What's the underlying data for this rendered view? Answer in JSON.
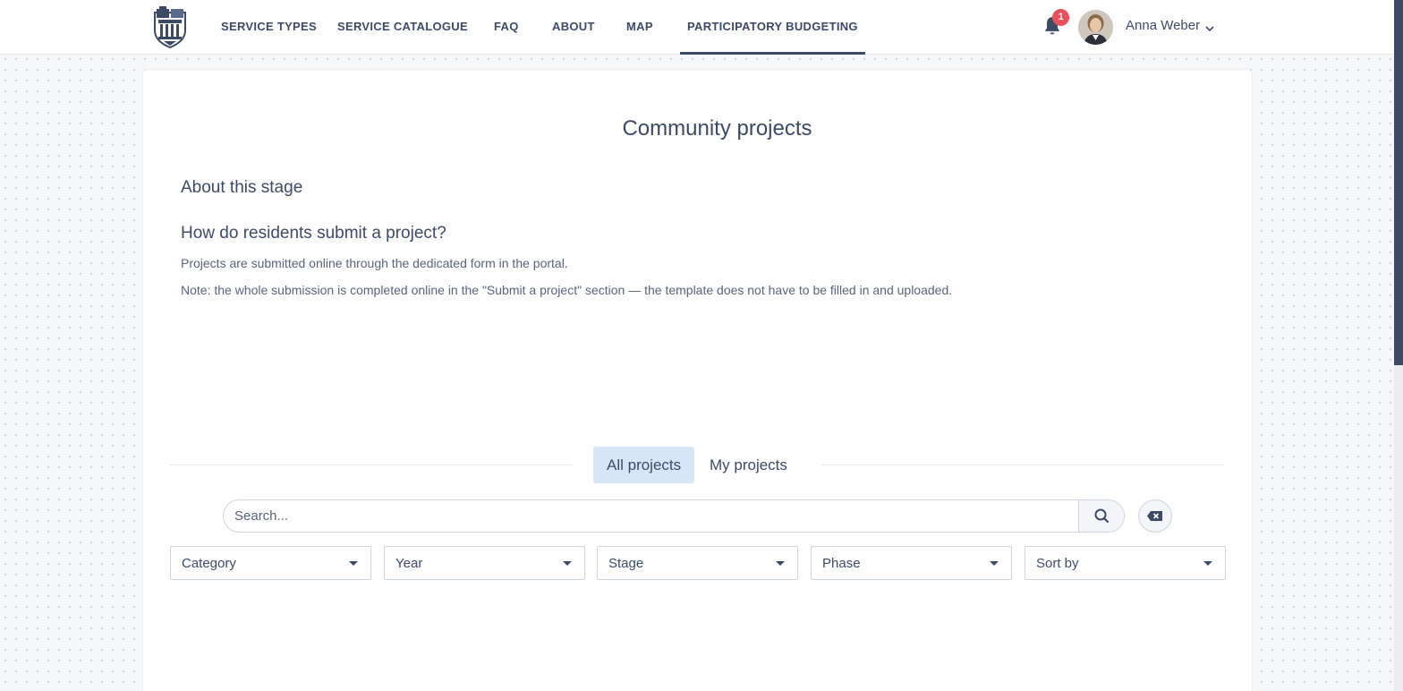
{
  "nav": {
    "items": [
      {
        "label": "SERVICE TYPES"
      },
      {
        "label": "SERVICE CATALOGUE"
      },
      {
        "label": "FAQ"
      },
      {
        "label": "ABOUT"
      },
      {
        "label": "MAP"
      },
      {
        "label": "PARTICIPATORY BUDGETING"
      }
    ],
    "active_index": 5
  },
  "notifications": {
    "count": "1"
  },
  "user": {
    "name": "Anna Weber"
  },
  "page": {
    "title": "Community projects",
    "stage_heading": "About this stage",
    "question_heading": "How do residents submit a project?",
    "paragraph_1": "Projects are submitted online through the dedicated form in the portal.",
    "paragraph_2": "Note: the whole submission is completed online in the \"Submit a project\" section — the template does not have to be filled in and uploaded."
  },
  "tabs": [
    {
      "label": "All projects",
      "active": true
    },
    {
      "label": "My projects",
      "active": false
    }
  ],
  "search": {
    "placeholder": "Search...",
    "value": ""
  },
  "filters": [
    {
      "label": "Category"
    },
    {
      "label": "Year"
    },
    {
      "label": "Stage"
    },
    {
      "label": "Phase"
    },
    {
      "label": "Sort by"
    }
  ],
  "colors": {
    "primary": "#3d4a66",
    "accent_tab": "#d6e6f7",
    "badge": "#e8505b"
  }
}
